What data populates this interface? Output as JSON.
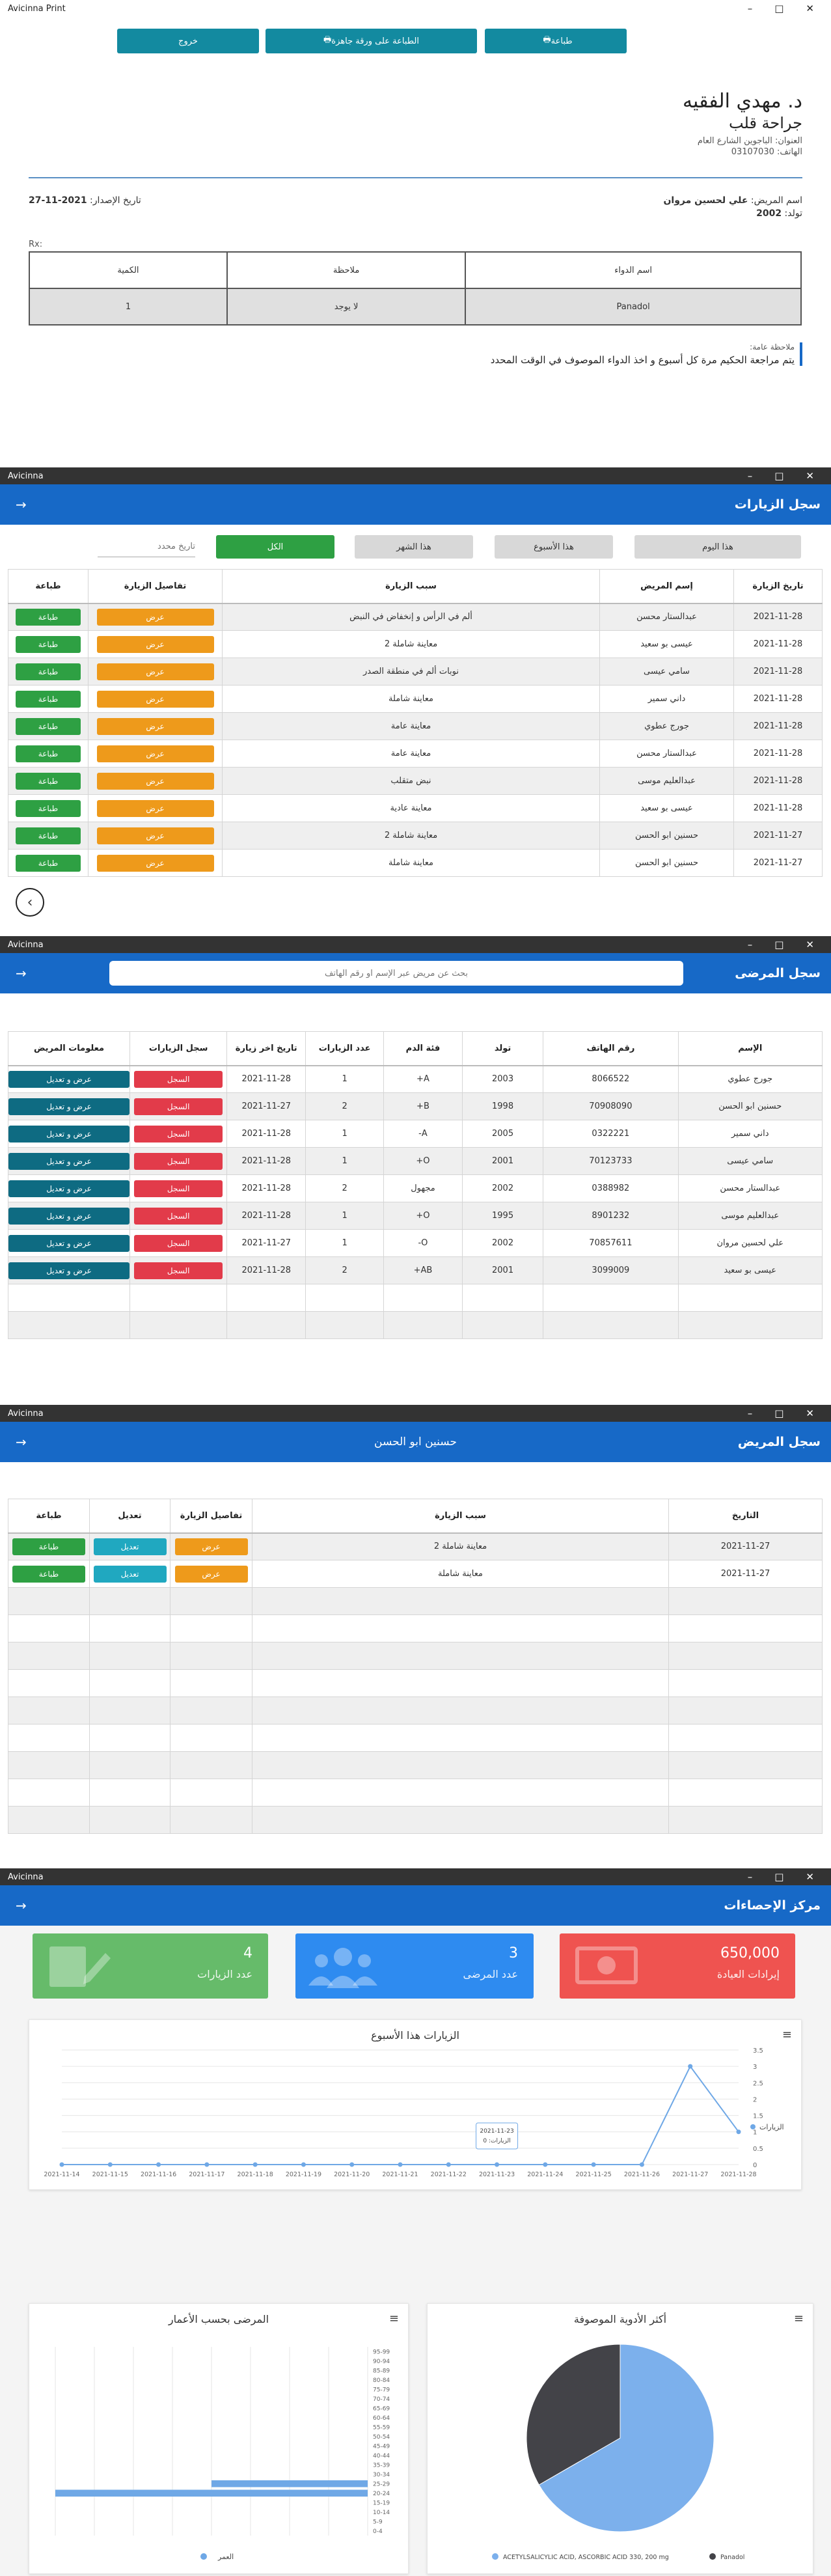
{
  "print_window": {
    "title": "Avicinna Print",
    "buttons": {
      "print": "طباعة",
      "print_ready": "الطباعة على ورقة جاهزة",
      "exit": "خروج"
    },
    "doctor": {
      "name": "د. مهدي الفقيه",
      "specialty": "جراحة قلب",
      "address_label": "العنوان:",
      "address": "الباجوين الشارع العام",
      "phone_label": "الهاتف:",
      "phone": "03107030"
    },
    "patient_label": "اسم المريض:",
    "patient_name": "علي لحسين مروان",
    "birth_label": "تولد:",
    "birth_year": "2002",
    "date_label": "تاريخ الإصدار:",
    "date": "2021-11-27",
    "rx": "Rx:",
    "rx_headers": [
      "اسم الدواء",
      "ملاحظة",
      "الكمية"
    ],
    "rx_row": [
      "Panadol",
      "لا يوجد",
      "1"
    ],
    "note_label": "ملاحظة عامة:",
    "note_text": "يتم مراجعة الحكيم مرة كل أسبوع و اخذ الدواء الموصوف في الوقت المحدد"
  },
  "visits_window": {
    "app": "Avicinna",
    "title": "سجل الزيارات",
    "filters": {
      "today": "هذا اليوم",
      "week": "هذا الأسبوع",
      "month": "هذا الشهر",
      "all": "الكل",
      "date_placeholder": "تاريخ محدد"
    },
    "headers": [
      "تاريخ الزيارة",
      "إسم المريض",
      "سبب الزيارة",
      "تفاصيل الزيارة",
      "طباعة"
    ],
    "view_label": "عرض",
    "print_label": "طباعة",
    "rows": [
      {
        "date": "2021-11-28",
        "name": "عبدالستار محسن",
        "reason": "ألم في الرأس و إنخفاض في النبض"
      },
      {
        "date": "2021-11-28",
        "name": "عيسى بو سعيد",
        "reason": "معاينة شاملة 2"
      },
      {
        "date": "2021-11-28",
        "name": "سامي عيسى",
        "reason": "نوبات ألم في منطقة الصدر"
      },
      {
        "date": "2021-11-28",
        "name": "داني سمير",
        "reason": "معاينة شاملة"
      },
      {
        "date": "2021-11-28",
        "name": "جورج عطوي",
        "reason": "معاينة عامة"
      },
      {
        "date": "2021-11-28",
        "name": "عبدالستار محسن",
        "reason": "معاينة عامة"
      },
      {
        "date": "2021-11-28",
        "name": "عبدالعليم موسى",
        "reason": "نبض متقلب"
      },
      {
        "date": "2021-11-28",
        "name": "عيسى بو سعيد",
        "reason": "معاينة عادية"
      },
      {
        "date": "2021-11-27",
        "name": "حسنين ابو الحسن",
        "reason": "معاينة شاملة 2"
      },
      {
        "date": "2021-11-27",
        "name": "حسنين ابو الحسن",
        "reason": "معاينة شاملة"
      }
    ]
  },
  "patients_window": {
    "app": "Avicinna",
    "title": "سجل المرضى",
    "search_placeholder": "بحث عن مريض عبر الإسم او رقم الهاتف",
    "headers": [
      "الإسم",
      "رقم الهاتف",
      "تولد",
      "فئة الدم",
      "عدد الزيارات",
      "تاريخ اخر زيارة",
      "سجل الزيارات",
      "معلومات المريض"
    ],
    "record_label": "السجل",
    "edit_label": "عرض و تعديل",
    "rows": [
      {
        "name": "جورج عطوي",
        "phone": "8066522",
        "birth": "2003",
        "blood": "A+",
        "visits": "1",
        "last": "2021-11-28"
      },
      {
        "name": "حسنين ابو الحسن",
        "phone": "70908090",
        "birth": "1998",
        "blood": "B+",
        "visits": "2",
        "last": "2021-11-27"
      },
      {
        "name": "داني سمير",
        "phone": "0322221",
        "birth": "2005",
        "blood": "A-",
        "visits": "1",
        "last": "2021-11-28"
      },
      {
        "name": "سامي عيسى",
        "phone": "70123733",
        "birth": "2001",
        "blood": "O+",
        "visits": "1",
        "last": "2021-11-28"
      },
      {
        "name": "عبدالستار محسن",
        "phone": "0388982",
        "birth": "2002",
        "blood": "مجهول",
        "visits": "2",
        "last": "2021-11-28"
      },
      {
        "name": "عبدالعليم موسى",
        "phone": "8901232",
        "birth": "1995",
        "blood": "O+",
        "visits": "1",
        "last": "2021-11-28"
      },
      {
        "name": "علي لحسين مروان",
        "phone": "70857611",
        "birth": "2002",
        "blood": "O-",
        "visits": "1",
        "last": "2021-11-27"
      },
      {
        "name": "عيسى بو سعيد",
        "phone": "3099009",
        "birth": "2001",
        "blood": "AB+",
        "visits": "2",
        "last": "2021-11-28"
      }
    ]
  },
  "patient_record_window": {
    "app": "Avicinna",
    "title": "سجل المريض",
    "patient": "حسنين ابو الحسن",
    "headers": [
      "التاريخ",
      "سبب الزيارة",
      "تفاصيل الزيارة",
      "تعديل",
      "طباعة"
    ],
    "view_label": "عرض",
    "edit_label": "تعديل",
    "print_label": "طباعة",
    "rows": [
      {
        "date": "2021-11-27",
        "reason": "معاينة شاملة 2"
      },
      {
        "date": "2021-11-27",
        "reason": "معاينة شاملة"
      }
    ]
  },
  "stats_window": {
    "app": "Avicinna",
    "title": "مركز الإحصاءات",
    "cards": [
      {
        "value": "650,000",
        "label": "إيرادات العيادة",
        "color": "#ef5350"
      },
      {
        "value": "3",
        "label": "عدد المرضى",
        "color": "#2e8bf0"
      },
      {
        "value": "4",
        "label": "عدد الزيارات",
        "color": "#66bb6a"
      }
    ]
  },
  "chart_data": [
    {
      "type": "line",
      "title": "الزيارات هذا الأسبوع",
      "x": [
        "2021-11-14",
        "2021-11-15",
        "2021-11-16",
        "2021-11-17",
        "2021-11-18",
        "2021-11-19",
        "2021-11-20",
        "2021-11-21",
        "2021-11-22",
        "2021-11-23",
        "2021-11-24",
        "2021-11-25",
        "2021-11-26",
        "2021-11-27",
        "2021-11-28"
      ],
      "series": [
        {
          "name": "الزيارات",
          "values": [
            0,
            0,
            0,
            0,
            0,
            0,
            0,
            0,
            0,
            0,
            0,
            0,
            0,
            3,
            1
          ]
        }
      ],
      "ylim": [
        0,
        3.5
      ],
      "yticks": [
        "0",
        "0.5",
        "1",
        "1.5",
        "2",
        "2.5",
        "3",
        "3.5"
      ],
      "tooltip": {
        "date": "2021-11-23",
        "text": "الزيارات: 0"
      },
      "color": "#6fa8e6"
    },
    {
      "type": "bar",
      "title": "المرضى بحسب الأعمار",
      "categories": [
        "0-4",
        "5-9",
        "10-14",
        "15-19",
        "20-24",
        "25-29",
        "30-34",
        "35-39",
        "40-44",
        "45-49",
        "50-54",
        "55-59",
        "60-64",
        "65-69",
        "70-74",
        "75-79",
        "80-84",
        "85-89",
        "90-94",
        "95-99"
      ],
      "series": [
        {
          "name": "العمر",
          "values": [
            0,
            0,
            0,
            0,
            2,
            1,
            0,
            0,
            0,
            0,
            0,
            0,
            0,
            0,
            0,
            0,
            0,
            0,
            0,
            0
          ]
        }
      ],
      "orientation": "horizontal",
      "color": "#6fa8e6"
    },
    {
      "type": "pie",
      "title": "أكثر الأدوية الموصوفة",
      "labels": [
        "ACETYLSALICYLIC ACID, ASCORBIC ACID 330, 200 mg",
        "Panadol"
      ],
      "values": [
        2,
        1
      ],
      "colors": [
        "#7cb0ec",
        "#434348"
      ]
    }
  ]
}
